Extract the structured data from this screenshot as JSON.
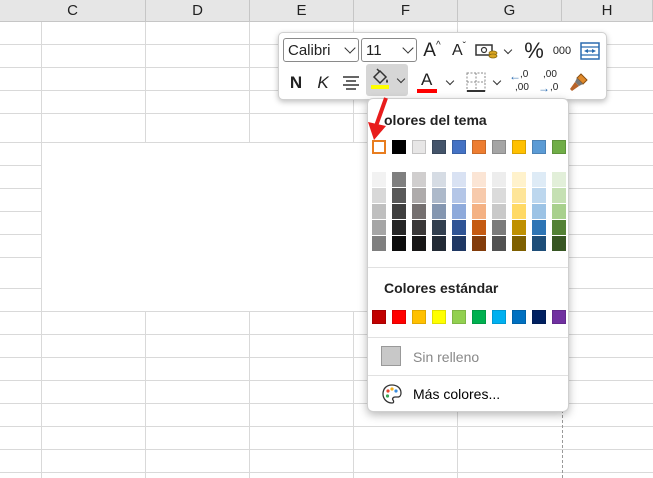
{
  "columns": [
    "C",
    "D",
    "E",
    "F",
    "G",
    "H"
  ],
  "toolbar": {
    "font_name": "Calibri",
    "font_size": "11",
    "increase_font": "A",
    "decrease_font": "A",
    "percent": "%",
    "thousands": "000",
    "bold": "N",
    "italic": "K",
    "font_color_letter": "A",
    "increase_decimal": ",0",
    "increase_decimal_bottom": ",00",
    "decrease_decimal": ",00",
    "decrease_decimal_bottom": ",0",
    "fill_color": "#ffff00",
    "font_color": "#ff0000"
  },
  "menu": {
    "theme_title": "Colores del tema",
    "theme_title_visible": "olores del tema",
    "standard_title": "Colores estándar",
    "no_fill": "Sin relleno",
    "more_colors": "Más colores...",
    "theme_colors": [
      "#ffffff",
      "#000000",
      "#e7e6e6",
      "#44546a",
      "#4472c4",
      "#ed7d31",
      "#a5a5a5",
      "#ffc000",
      "#5b9bd5",
      "#70ad47"
    ],
    "theme_shades": [
      [
        "#f2f2f2",
        "#7f7f7f",
        "#d0cece",
        "#d6dce4",
        "#d9e2f3",
        "#fbe5d5",
        "#ededed",
        "#fff2cc",
        "#deebf6",
        "#e2efd9"
      ],
      [
        "#d8d8d8",
        "#595959",
        "#aeabab",
        "#adb9ca",
        "#b4c6e7",
        "#f7caac",
        "#dbdbdb",
        "#fee599",
        "#bdd7ee",
        "#c5e0b3"
      ],
      [
        "#bfbfbf",
        "#3f3f3f",
        "#757070",
        "#8496b0",
        "#8eaadb",
        "#f4b183",
        "#c9c9c9",
        "#ffd965",
        "#9cc3e5",
        "#a8d08d"
      ],
      [
        "#a5a5a5",
        "#262626",
        "#3a3838",
        "#323f4f",
        "#2f5496",
        "#c55a11",
        "#7b7b7b",
        "#bf9000",
        "#2e75b5",
        "#538135"
      ],
      [
        "#7f7f7f",
        "#0c0c0c",
        "#171616",
        "#222a35",
        "#1f3864",
        "#833c0b",
        "#525252",
        "#7f6000",
        "#1e4e79",
        "#375623"
      ]
    ],
    "standard_colors": [
      "#c00000",
      "#ff0000",
      "#ffc000",
      "#ffff00",
      "#92d050",
      "#00b050",
      "#00b0f0",
      "#0070c0",
      "#002060",
      "#7030a0"
    ],
    "selected_border": "#e87d1f",
    "arrow_color": "#e81c1c"
  }
}
